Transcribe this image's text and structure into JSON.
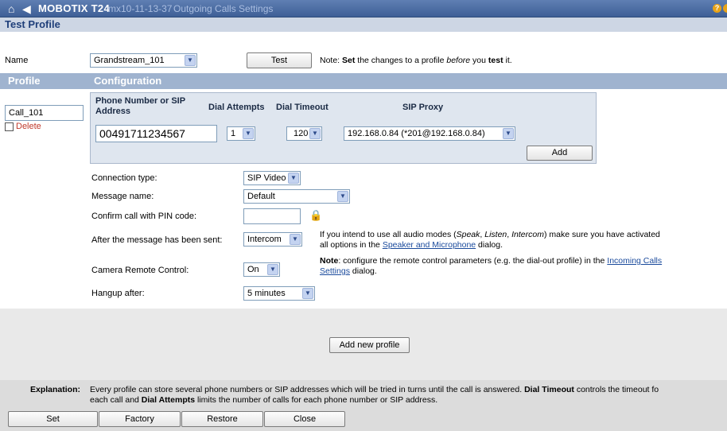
{
  "titlebar": {
    "brand": "MOBOTIX T24",
    "camera": "mx10-11-13-37",
    "page": "Outgoing Calls Settings"
  },
  "test_profile": {
    "header": "Test Profile",
    "name_label": "Name",
    "name_value": "Grandstream_101",
    "test_button": "Test",
    "note_prefix": "Note: ",
    "note_set": "Set",
    "note_mid": " the changes to a profile ",
    "note_before": "before",
    "note_you": " you ",
    "note_test": "test",
    "note_end": " it."
  },
  "profile": {
    "header": "Profile",
    "config_header": "Configuration",
    "profile_name": "Call_101",
    "delete_label": "Delete"
  },
  "phone_table": {
    "col_number": "Phone Number or SIP Address",
    "col_attempts": "Dial Attempts",
    "col_timeout": "Dial Timeout",
    "col_proxy": "SIP Proxy",
    "number": "00491711234567",
    "attempts": "1",
    "timeout": "120",
    "proxy": "192.168.0.84 (*201@192.168.0.84)",
    "add_button": "Add"
  },
  "settings": {
    "connection_label": "Connection type:",
    "connection_value": "SIP Video",
    "message_label": "Message name:",
    "message_value": "Default",
    "pin_label": "Confirm call with PIN code:",
    "pin_value": "",
    "after_label": "After the message has been sent:",
    "after_value": "Intercom",
    "after_note_1": "If you intend to use all audio modes (",
    "after_note_speak": "Speak",
    "after_note_c1": ", ",
    "after_note_listen": "Listen",
    "after_note_c2": ", ",
    "after_note_intercom": "Intercom",
    "after_note_2": ") make sure you have activated",
    "after_note_3": "all options in the ",
    "after_note_link": "Speaker and Microphone",
    "after_note_4": " dialog.",
    "camera_label": "Camera Remote Control:",
    "camera_value": "On",
    "camera_note_bold": "Note",
    "camera_note_1": ": configure the remote control parameters (e.g. the dial-out profile) in the ",
    "camera_note_link1": "Incoming Calls",
    "camera_note_link2": "Settings",
    "camera_note_2": " dialog.",
    "hangup_label": "Hangup after:",
    "hangup_value": "5 minutes"
  },
  "add_profile_button": "Add new profile",
  "explanation": {
    "label": "Explanation:",
    "text_1": "Every profile can store several phone numbers or SIP addresses which will be tried in turns until the call is answered. ",
    "dial_timeout": "Dial Timeout",
    "text_2": " controls the timeout fo",
    "text_3": "each call and ",
    "dial_attempts": "Dial Attempts",
    "text_4": " limits the number of calls for each phone number or SIP address."
  },
  "footer_buttons": {
    "set": "Set",
    "factory": "Factory",
    "restore": "Restore",
    "close": "Close"
  },
  "colors": {
    "titlebar": "#3e5f96",
    "section_header": "#cdd6e4",
    "profile_header": "#9fb3cf",
    "link": "#1a4a9c",
    "delete": "#c0392b"
  }
}
